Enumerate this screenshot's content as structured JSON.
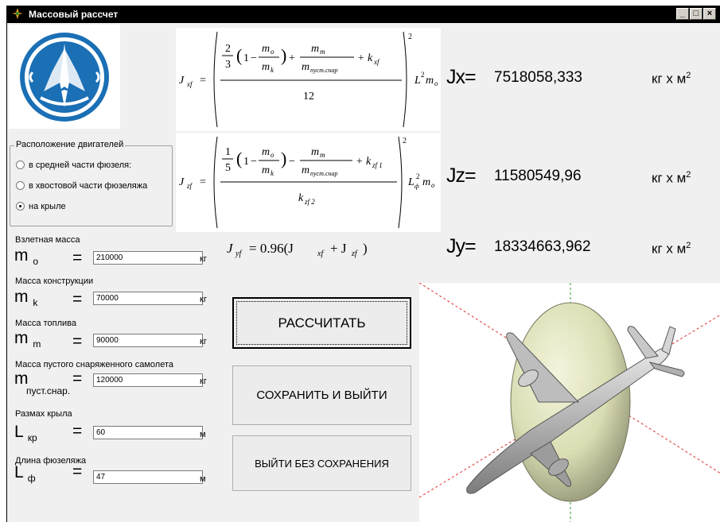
{
  "window": {
    "title": "Массовый рассчет",
    "controls": [
      "_",
      "□",
      "×"
    ]
  },
  "results": [
    {
      "label": "Jx=",
      "value": "7518058,333",
      "unit": "кг х м",
      "unit_exp": "2"
    },
    {
      "label": "Jz=",
      "value": "11580549,96",
      "unit": "кг х м",
      "unit_exp": "2"
    },
    {
      "label": "Jy=",
      "value": "18334663,962",
      "unit": "кг х м",
      "unit_exp": "2"
    }
  ],
  "engines": {
    "title": "Расположение двигателей",
    "options": [
      {
        "label": "в средней части фюзеля:",
        "checked": false
      },
      {
        "label": "в хвостовой части фюзеляжа",
        "checked": false
      },
      {
        "label": "на крыле",
        "checked": true
      }
    ]
  },
  "fields": [
    {
      "label": "Взлетная масса",
      "symbol": "m",
      "sub": "o",
      "eq": "=",
      "value": "210000",
      "unit": "кг"
    },
    {
      "label": "Масса конструкции",
      "symbol": "m",
      "sub": "k",
      "eq": "=",
      "value": "70000",
      "unit": "кг"
    },
    {
      "label": "Масса топлива",
      "symbol": "m",
      "sub": "m",
      "eq": "=",
      "value": "90000",
      "unit": "кг"
    },
    {
      "label": "Масса пустого снаряженного самолета",
      "symbol": "m",
      "sub": "пуст.снар.",
      "eq": "=",
      "value": "120000",
      "unit": "кг"
    },
    {
      "label": "Размах крыла",
      "symbol": "L",
      "sub": "кр",
      "eq": "=",
      "value": "60",
      "unit": "м"
    },
    {
      "label": "Длина фюзеляжа",
      "symbol": "L",
      "sub": "ф",
      "eq": "=",
      "value": "47",
      "unit": "м"
    }
  ],
  "buttons": {
    "calculate": "РАССЧИТАТЬ",
    "save_exit": "СОХРАНИТЬ И ВЫЙТИ",
    "exit_no_save": "ВЫЙТИ БЕЗ СОХРАНЕНИЯ"
  },
  "formulas": {
    "f1": {
      "lhs": "J",
      "lhs_sub": "xf",
      "two": "2",
      "three": "3",
      "one": "1",
      "mo": "m",
      "mo_sub": "o",
      "mk": "m",
      "mk_sub": "k",
      "mm": "m",
      "mm_sub": "m",
      "mpust": "m",
      "mpust_sub": "пуст.снар",
      "plus_k": "+ k",
      "k_sub": "xf",
      "denom": "12",
      "tail": "L",
      "tail_exp": "2",
      "tail_m": "m",
      "tail_m_sub": "o",
      "outer_exp": "2"
    },
    "f2": {
      "lhs": "J",
      "lhs_sub": "zf",
      "one_top": "1",
      "five": "5",
      "one": "1",
      "mo": "m",
      "mo_sub": "o",
      "mk": "m",
      "mk_sub": "k",
      "mm": "m",
      "mm_sub": "m",
      "mpust": "m",
      "mpust_sub": "пуст.снар",
      "plus_k": "+ k",
      "k_sub": "zf 1",
      "denom_k": "k",
      "denom_sub": "zf 2",
      "tail": "L",
      "tail_sub": "ф",
      "tail_exp": "2",
      "tail_m": "m",
      "tail_m_sub": "o",
      "outer_exp": "2"
    },
    "f3": {
      "text_lhs": "J",
      "lhs_sub": "yf",
      "text_mid": "= 0.96(J",
      "mid_sub": "xf",
      "plus": "+ J",
      "end_sub": "zf",
      "close": ")"
    }
  },
  "colors": {
    "titlebar": "#000000",
    "window_bg": "#f0f0f0",
    "logo_blue": "#1a6fb5",
    "ellipsoid": "#d9dcb0"
  }
}
